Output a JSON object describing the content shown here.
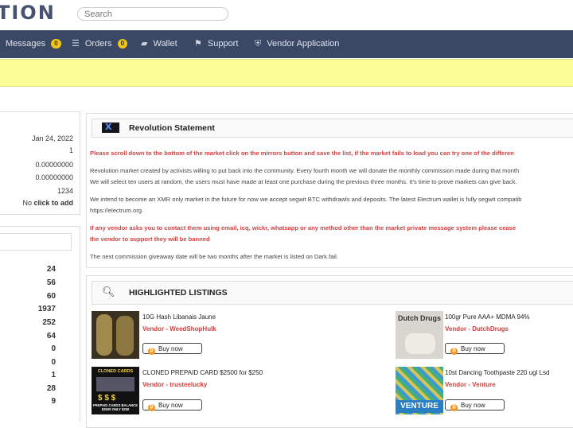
{
  "header": {
    "logo_text": "TION",
    "search_placeholder": "Search"
  },
  "nav": {
    "items": [
      {
        "label": "Messages",
        "badge": "0",
        "icon": "envelope-icon"
      },
      {
        "label": "Orders",
        "badge": "0",
        "icon": "list-icon"
      },
      {
        "label": "Wallet",
        "icon": "wallet-icon"
      },
      {
        "label": "Support",
        "icon": "support-icon"
      },
      {
        "label": "Vendor Application",
        "icon": "shield-icon"
      }
    ]
  },
  "account": {
    "rows": [
      {
        "value": "Jan 24, 2022"
      },
      {
        "value": "1"
      },
      {
        "value": "0.00000000"
      },
      {
        "value": "0.00000000"
      },
      {
        "value": "1234"
      },
      {
        "value_prefix": "No",
        "value_link": "click to add"
      }
    ]
  },
  "categories": {
    "counts": [
      "24",
      "56",
      "60",
      "1937",
      "252",
      "64",
      "0",
      "0",
      "1",
      "28",
      "9"
    ]
  },
  "statement": {
    "title": "Revolution Statement",
    "logo_letter": "X",
    "red_notice": "Please scroll down to the bottom of the market click on the mirrors button and save the list, if the market fails to load you can try one of the differen",
    "para1_line1": "Revolution market created by activists willing to put back into the community. Every fourth month we will donate the monthly commission made during that month",
    "para1_line2": "We will select ten users at random, the users must have made at least one purchase during the previous three months. It's time to prove markets can give back.",
    "para2_line1": "We intend to become an XMR only market in the future for now we accept segwit BTC withdrawls and deposits. The latest Electrum wallet is fully segwit compatib",
    "para2_line2": "https://electrum.org.",
    "red_warning_line1": "If any vendor asks you to contact them using email, icq, wickr, whatsapp or any method other than the market private message system please cease",
    "red_warning_line2": "the vendor to support they will be banned",
    "giveaway": "The next commission giveaway date will be two months after the market is listed on Dark.fail."
  },
  "listings": {
    "title": "HIGHLIGHTED LISTINGS",
    "buy_label": "Buy now",
    "items": [
      {
        "title": "10G Hash Libanais Jaune",
        "vendor": "Vendor - WeedShopHulk"
      },
      {
        "title": "100gr Pure AAA+ MDMA 94%",
        "vendor": "Vendor - DutchDrugs",
        "thumb_text": "Dutch Drugs"
      },
      {
        "title": "CLONED PREPAID CARD $2500 for $250",
        "vendor": "Vendor - trusteelucky",
        "thumb_text": "CLONED CARDS",
        "thumb_text2": "PREPAID CARDS BALANCE $2500 ONLY $250"
      },
      {
        "title": "10st Dancing Toothpaste 220 ugl Lsd",
        "vendor": "Vendor - Venture",
        "thumb_text": "VENTURE"
      }
    ]
  },
  "colors": {
    "nav_bg": "#3a4865",
    "banner_bg": "#fdfd97",
    "badge": "#f0c419",
    "red_text": "#d04040",
    "bitcoin": "#f7931a"
  }
}
